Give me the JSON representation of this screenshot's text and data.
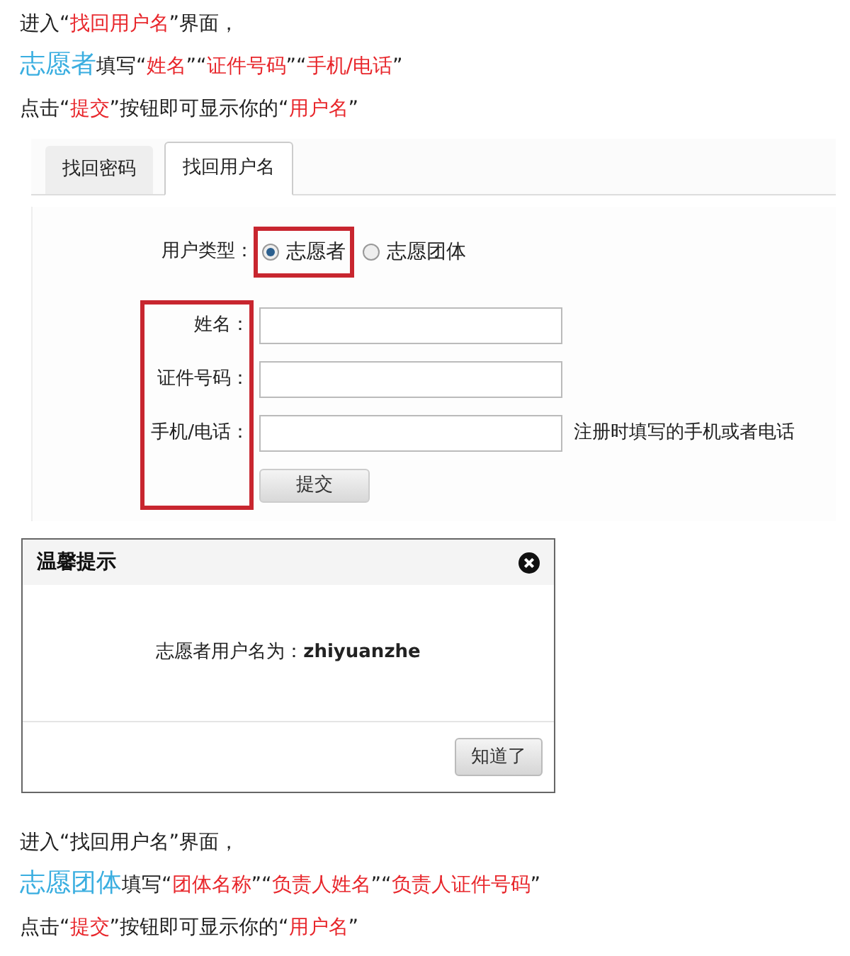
{
  "intro_1": {
    "lines": [
      {
        "segments": [
          {
            "kind": "plain",
            "text": "进入“"
          },
          {
            "kind": "highlight",
            "text": "找回用户名"
          },
          {
            "kind": "plain",
            "text": "”界面，"
          }
        ]
      },
      {
        "segments": [
          {
            "kind": "keyword",
            "text": "志愿者"
          },
          {
            "kind": "plain",
            "text": "填写“"
          },
          {
            "kind": "highlight",
            "text": "姓名"
          },
          {
            "kind": "plain",
            "text": "”“"
          },
          {
            "kind": "highlight",
            "text": "证件号码"
          },
          {
            "kind": "plain",
            "text": "”“"
          },
          {
            "kind": "highlight",
            "text": "手机/电话"
          },
          {
            "kind": "plain",
            "text": "”"
          }
        ]
      },
      {
        "segments": [
          {
            "kind": "plain",
            "text": "点击“"
          },
          {
            "kind": "highlight",
            "text": "提交"
          },
          {
            "kind": "plain",
            "text": "”按钮即可显示你的“"
          },
          {
            "kind": "highlight",
            "text": "用户名"
          },
          {
            "kind": "plain",
            "text": "”"
          }
        ]
      }
    ]
  },
  "form": {
    "tabs": [
      {
        "label": "找回密码",
        "selected": false
      },
      {
        "label": "找回用户名",
        "selected": true
      }
    ],
    "user_type": {
      "label": "用户类型：",
      "options": [
        {
          "label": "志愿者",
          "selected": true,
          "highlighted": true
        },
        {
          "label": "志愿团体",
          "selected": false,
          "highlighted": false
        }
      ]
    },
    "labels_highlighted": true,
    "fields": [
      {
        "label": "姓名："
      },
      {
        "label": "证件号码："
      },
      {
        "label": "手机/电话：",
        "hint": "注册时填写的手机或者电话"
      }
    ],
    "submit": "提交"
  },
  "dialog": {
    "title": "温馨提示",
    "message": "志愿者用户名为：**zhiyuanzhe**",
    "button": "知道了"
  },
  "intro_2": {
    "lines": [
      {
        "segments": [
          {
            "kind": "plain",
            "text": "进入“找回用户名”界面，"
          }
        ]
      },
      {
        "segments": [
          {
            "kind": "keyword",
            "text": "志愿团体"
          },
          {
            "kind": "plain",
            "text": "填写“"
          },
          {
            "kind": "highlight",
            "text": "团体名称"
          },
          {
            "kind": "plain",
            "text": "”“"
          },
          {
            "kind": "highlight",
            "text": "负责人姓名"
          },
          {
            "kind": "plain",
            "text": "”“"
          },
          {
            "kind": "highlight",
            "text": "负责人证件号码"
          },
          {
            "kind": "plain",
            "text": "”"
          }
        ]
      },
      {
        "segments": [
          {
            "kind": "plain",
            "text": "点击“"
          },
          {
            "kind": "highlight",
            "text": "提交"
          },
          {
            "kind": "plain",
            "text": "”按钮即可显示你的“"
          },
          {
            "kind": "highlight",
            "text": "用户名"
          },
          {
            "kind": "plain",
            "text": "”"
          }
        ]
      }
    ]
  }
}
